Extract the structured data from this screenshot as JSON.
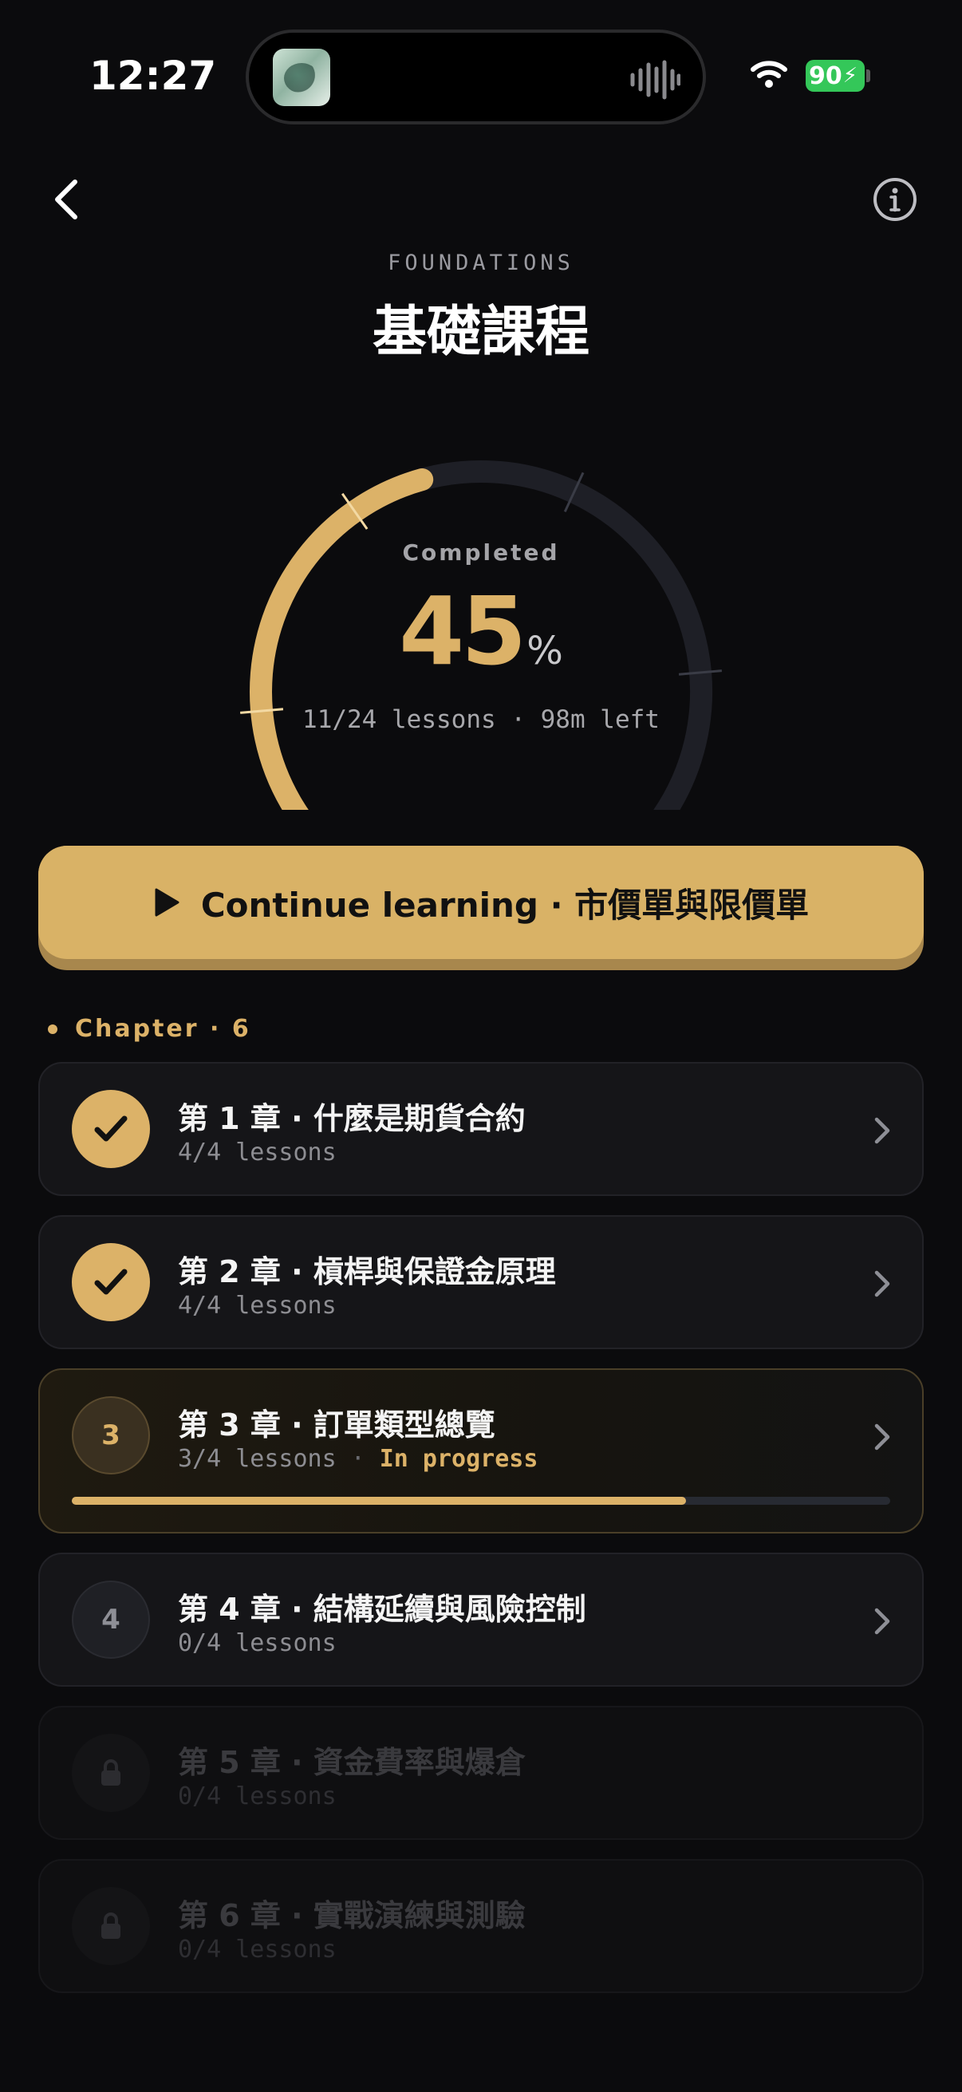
{
  "status_bar": {
    "time": "12:27",
    "battery": "90",
    "icons": [
      "app-thumbnail-icon",
      "audio-waveform-icon",
      "wifi-icon",
      "battery-charging-icon"
    ]
  },
  "header": {
    "back_icon": "chevron-left-icon",
    "info_icon": "info-circle-icon",
    "eyebrow": "FOUNDATIONS",
    "title": "基礎課程"
  },
  "progress": {
    "label": "Completed",
    "percent_value": "45",
    "percent_sign": "%",
    "percent_fraction": 0.45,
    "summary": "11/24 lessons · 98m left"
  },
  "continue_button": {
    "icon": "play-icon",
    "label": "Continue learning · 市價單與限價單"
  },
  "section": {
    "label": "Chapter · 6"
  },
  "chapters": [
    {
      "title": "第 1 章 · 什麼是期貨合約",
      "lessons": "4/4 lessons",
      "status": "completed",
      "badge": "checkmark-icon"
    },
    {
      "title": "第 2 章 · 槓桿與保證金原理",
      "lessons": "4/4 lessons",
      "status": "completed",
      "badge": "checkmark-icon"
    },
    {
      "title": "第 3 章 · 訂單類型總覽",
      "lessons": "3/4 lessons",
      "separator": "·",
      "status_label": "In progress",
      "badge": "3",
      "progress_fraction": 0.75
    },
    {
      "title": "第 4 章 · 結構延續與風險控制",
      "lessons": "0/4 lessons",
      "status": "not-started",
      "badge": "4"
    },
    {
      "title": "第 5 章 · 資金費率與爆倉",
      "lessons": "0/4 lessons",
      "status": "locked",
      "badge": "lock-icon"
    },
    {
      "title": "第 6 章 · 實戰演練與測驗",
      "lessons": "0/4 lessons",
      "status": "locked",
      "badge": "lock-icon"
    }
  ],
  "colors": {
    "background": "#0b0b0d",
    "accent_gold": "#dcb268",
    "card_bg": "#151518",
    "track": "#1f2027"
  }
}
